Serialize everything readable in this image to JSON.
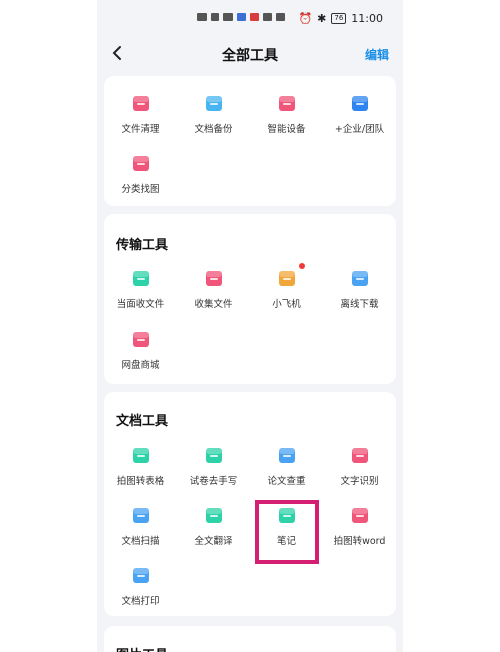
{
  "status": {
    "battery": "76",
    "time": "11:00"
  },
  "header": {
    "title": "全部工具",
    "edit_label": "编辑"
  },
  "section1": {
    "items": [
      {
        "label": "文件清理",
        "icon": "file-clean-icon",
        "color": "#f0557a"
      },
      {
        "label": "文档备份",
        "icon": "doc-backup-icon",
        "color": "#49b5f0"
      },
      {
        "label": "智能设备",
        "icon": "smart-device-icon",
        "color": "#f0557a"
      },
      {
        "label": "+企业/团队",
        "icon": "team-icon",
        "color": "#2f86f0"
      },
      {
        "label": "分类找图",
        "icon": "photo-category-icon",
        "color": "#f0557a"
      }
    ]
  },
  "transfer": {
    "title": "传输工具",
    "items": [
      {
        "label": "当面收文件",
        "icon": "face-receive-icon",
        "color": "#2ed2a8"
      },
      {
        "label": "收集文件",
        "icon": "collect-files-icon",
        "color": "#f0557a"
      },
      {
        "label": "小飞机",
        "icon": "paper-plane-icon",
        "color": "#f0a63a"
      },
      {
        "label": "离线下载",
        "icon": "offline-download-icon",
        "color": "#4aa3f2"
      },
      {
        "label": "网盘商城",
        "icon": "store-icon",
        "color": "#f0557a"
      }
    ]
  },
  "doc": {
    "title": "文档工具",
    "items": [
      {
        "label": "拍图转表格",
        "icon": "photo-to-table-icon",
        "color": "#2ed2a8"
      },
      {
        "label": "试卷去手写",
        "icon": "remove-handwriting-icon",
        "color": "#2ed2a8"
      },
      {
        "label": "论文查重",
        "icon": "paper-check-icon",
        "color": "#4aa3f2"
      },
      {
        "label": "文字识别",
        "icon": "text-recognition-icon",
        "color": "#f0557a"
      },
      {
        "label": "文档扫描",
        "icon": "doc-scan-icon",
        "color": "#4aa3f2"
      },
      {
        "label": "全文翻译",
        "icon": "translate-icon",
        "color": "#2ed2a8"
      },
      {
        "label": "笔记",
        "icon": "note-pen-icon",
        "color": "#2ed2a8"
      },
      {
        "label": "拍图转word",
        "icon": "photo-to-word-icon",
        "color": "#f0557a"
      },
      {
        "label": "文档打印",
        "icon": "doc-print-icon",
        "color": "#4aa3f2"
      }
    ]
  },
  "next_section": {
    "title": "图片工具"
  }
}
